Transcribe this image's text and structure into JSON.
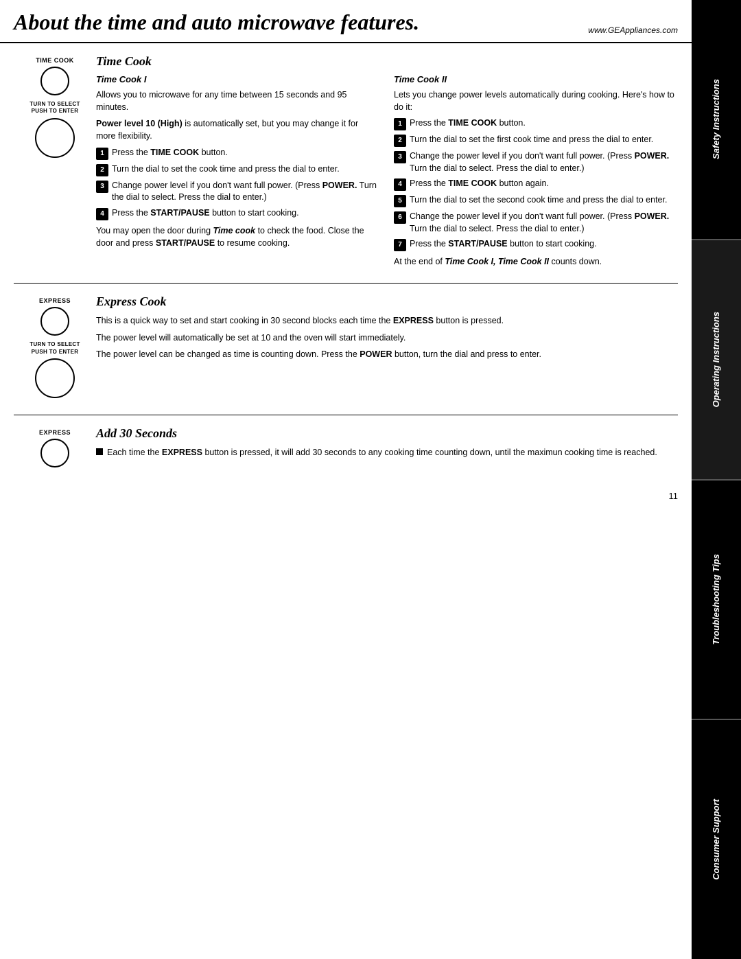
{
  "header": {
    "title": "About the time and auto microwave features.",
    "url": "www.GEAppliances.com"
  },
  "sidebar": {
    "items": [
      {
        "label": "Safety Instructions",
        "italic": true
      },
      {
        "label": "Operating Instructions",
        "italic": true,
        "active": true
      },
      {
        "label": "Troubleshooting Tips",
        "italic": true
      },
      {
        "label": "Consumer Support",
        "italic": true
      }
    ]
  },
  "timeCook": {
    "heading": "Time Cook",
    "icon_label": "TIME COOK",
    "turn_label": "TURN TO SELECT\nPUSH TO ENTER",
    "col1": {
      "subheading": "Time Cook I",
      "intro": "Allows you to microwave for any time between 15 seconds and 95 minutes.",
      "power_note": "Power level 10 (High) is automatically set, but you may change it for more flexibility.",
      "steps": [
        "Press the TIME COOK button.",
        "Turn the dial to set the cook time and press the dial to enter.",
        "Change power level if you don't want full power. (Press POWER. Turn the dial to select. Press the dial to enter.)",
        "Press the START/PAUSE button to start cooking."
      ],
      "footer1": "You may open the door during Time cook to check the food. Close the door and press START/PAUSE to resume cooking."
    },
    "col2": {
      "subheading": "Time Cook II",
      "intro": "Lets you change power levels automatically during cooking. Here's how to do it:",
      "steps": [
        "Press the TIME COOK button.",
        "Turn the dial to set the first cook time and press the dial to enter.",
        "Change the power level if you don't want full power. (Press POWER. Turn the dial to select. Press the dial to enter.)",
        "Press the TIME COOK button again.",
        "Turn the dial to set the second cook time and press the dial to enter.",
        "Change the power level if you don't want full power. (Press POWER. Turn the dial to select. Press the dial to enter.)",
        "Press the START/PAUSE button to start cooking."
      ],
      "footer": "At the end of Time Cook I, Time Cook II counts down."
    }
  },
  "expressCook": {
    "heading": "Express Cook",
    "icon_label": "EXPRESS",
    "turn_label": "TURN TO SELECT\nPUSH TO ENTER",
    "line1": "This is a quick way to set and start cooking in 30 second blocks each time the EXPRESS button is pressed.",
    "line2": "The power level will automatically be set at 10 and the oven will start immediately.",
    "line3": "The power level can be changed as time is counting down. Press the POWER button, turn the dial and press to enter."
  },
  "add30": {
    "heading": "Add 30 Seconds",
    "icon_label": "EXPRESS",
    "bullet": "Each time the EXPRESS button is pressed, it will add 30 seconds to any cooking time counting down, until the maximun cooking time is reached."
  },
  "page_number": "11"
}
